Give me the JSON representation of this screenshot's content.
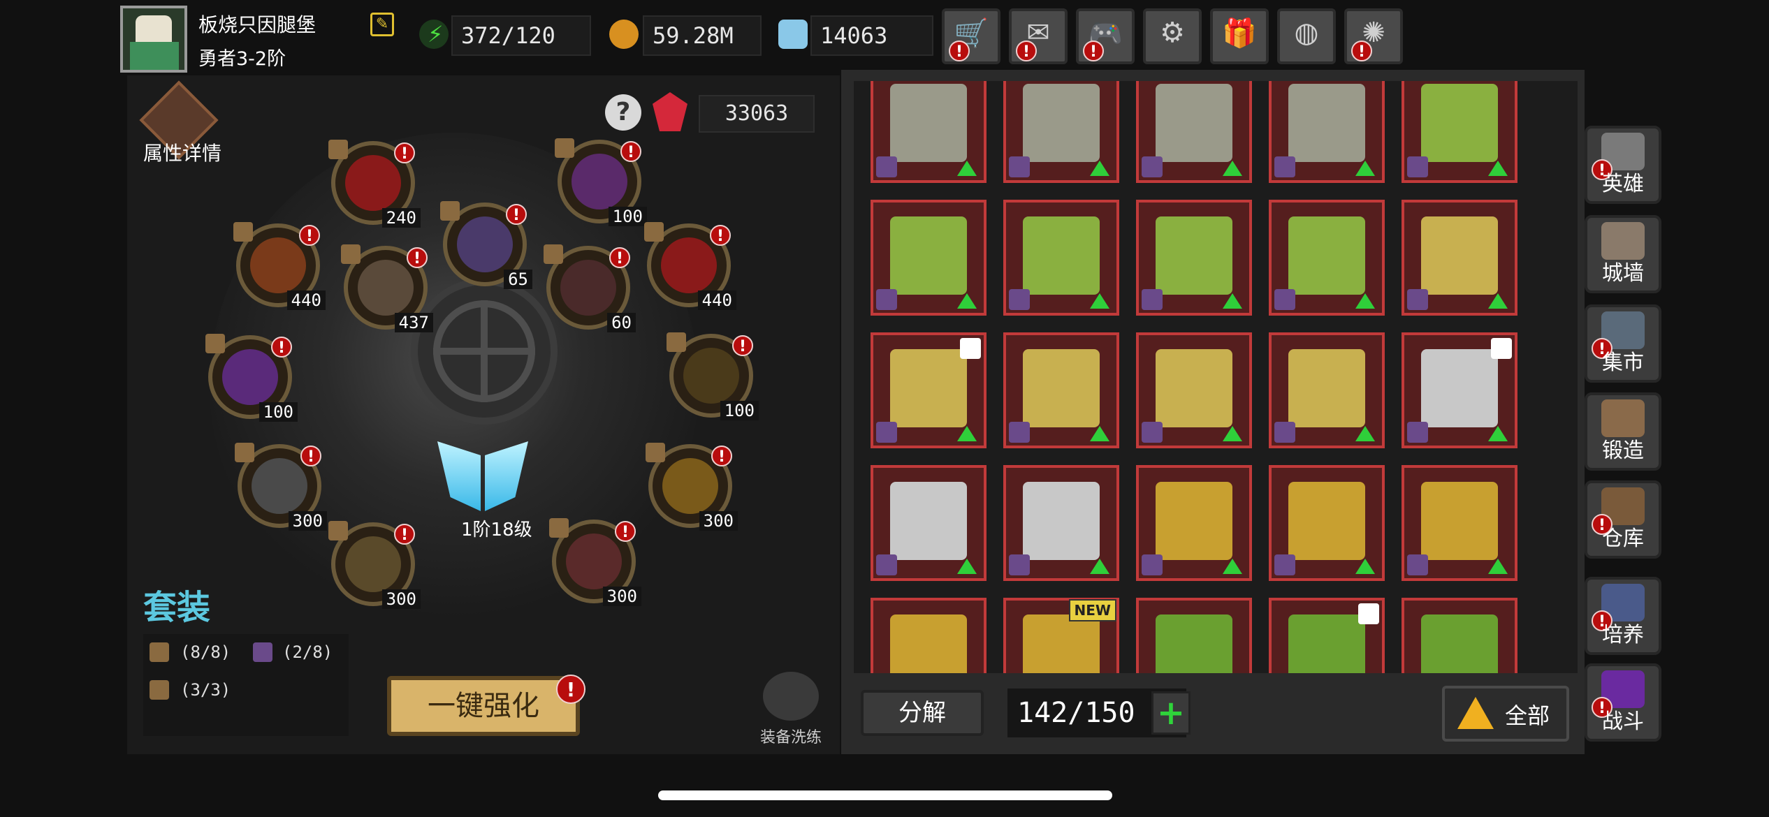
{
  "player": {
    "name": "板烧只因腿堡",
    "rank": "勇者3-2阶"
  },
  "resources": {
    "energy": "372/120",
    "gold": "59.28M",
    "diamonds": "14063"
  },
  "top_buttons": [
    {
      "name": "shop-button",
      "icon": "cart-icon",
      "glyph": "🛒",
      "alert": true
    },
    {
      "name": "mail-button",
      "icon": "mail-icon",
      "glyph": "✉",
      "alert": true
    },
    {
      "name": "games-button",
      "icon": "gamepad-icon",
      "glyph": "🎮",
      "alert": true
    },
    {
      "name": "settings-button",
      "icon": "gear-icon",
      "glyph": "⚙",
      "alert": false
    },
    {
      "name": "gift-button",
      "icon": "gift-icon",
      "glyph": "🎁",
      "alert": false
    },
    {
      "name": "wheel-button",
      "icon": "color-wheel-icon",
      "glyph": "◍",
      "alert": false
    },
    {
      "name": "fireworks-button",
      "icon": "firework-icon",
      "glyph": "✺",
      "alert": true
    }
  ],
  "attributes": {
    "label": "属性详情"
  },
  "gem_count": "33063",
  "equipment_slots": [
    {
      "id": "slot-crossbow",
      "level": "240",
      "color": "#8a1a1a"
    },
    {
      "id": "slot-bow",
      "level": "100",
      "color": "#5a2a6a"
    },
    {
      "id": "slot-dual-blades",
      "level": "440",
      "color": "#7a3a1a"
    },
    {
      "id": "slot-helmet-small",
      "level": "65",
      "color": "#4a3a6a"
    },
    {
      "id": "slot-potion",
      "level": "437",
      "color": "#5a4a3a"
    },
    {
      "id": "slot-bow-red",
      "level": "60",
      "color": "#4a2a2a"
    },
    {
      "id": "slot-axe",
      "level": "440",
      "color": "#8a1a1a"
    },
    {
      "id": "slot-tome",
      "level": "100",
      "color": "#5a2a7a"
    },
    {
      "id": "slot-staff",
      "level": "100",
      "color": "#4a3a1a"
    },
    {
      "id": "slot-helmet",
      "level": "300",
      "color": "#4a4a4a"
    },
    {
      "id": "slot-armor",
      "level": "300",
      "color": "#7a5a1a"
    },
    {
      "id": "slot-ring",
      "level": "300",
      "color": "#5a4a2a"
    },
    {
      "id": "slot-boots",
      "level": "300",
      "color": "#5a2a2a"
    }
  ],
  "wings": {
    "level": "1阶18级"
  },
  "set_bonus": {
    "title": "套装",
    "items": [
      "(8/8)",
      "(2/8)",
      "(3/3)"
    ]
  },
  "enhance_button": "一键强化",
  "refine": {
    "label": "装备洗练"
  },
  "inventory": {
    "items": [
      {
        "kind": "chest",
        "up": true,
        "lock": false,
        "new": false
      },
      {
        "kind": "chest",
        "up": true,
        "lock": false,
        "new": false
      },
      {
        "kind": "chest",
        "up": true,
        "lock": false,
        "new": false
      },
      {
        "kind": "chest",
        "up": true,
        "lock": false,
        "new": false
      },
      {
        "kind": "necklace",
        "up": true,
        "lock": false,
        "new": false
      },
      {
        "kind": "necklace",
        "up": true,
        "lock": false,
        "new": false
      },
      {
        "kind": "necklace",
        "up": true,
        "lock": false,
        "new": false
      },
      {
        "kind": "necklace",
        "up": true,
        "lock": false,
        "new": false
      },
      {
        "kind": "necklace",
        "up": true,
        "lock": false,
        "new": false
      },
      {
        "kind": "gauntlets",
        "up": true,
        "lock": false,
        "new": false
      },
      {
        "kind": "gauntlets",
        "up": true,
        "lock": true,
        "new": false
      },
      {
        "kind": "gauntlets",
        "up": true,
        "lock": false,
        "new": false
      },
      {
        "kind": "gauntlets",
        "up": true,
        "lock": false,
        "new": false
      },
      {
        "kind": "gauntlets",
        "up": true,
        "lock": false,
        "new": false
      },
      {
        "kind": "claw",
        "up": true,
        "lock": true,
        "new": false
      },
      {
        "kind": "claw",
        "up": true,
        "lock": false,
        "new": false
      },
      {
        "kind": "claw",
        "up": true,
        "lock": false,
        "new": false
      },
      {
        "kind": "ring",
        "up": true,
        "lock": false,
        "new": false
      },
      {
        "kind": "ring",
        "up": true,
        "lock": false,
        "new": false
      },
      {
        "kind": "ring",
        "up": true,
        "lock": false,
        "new": false
      },
      {
        "kind": "ring",
        "up": false,
        "lock": false,
        "new": false
      },
      {
        "kind": "ring",
        "up": false,
        "lock": false,
        "new": true
      },
      {
        "kind": "vine",
        "up": false,
        "lock": false,
        "new": false
      },
      {
        "kind": "vine",
        "up": false,
        "lock": true,
        "new": false
      },
      {
        "kind": "vine",
        "up": false,
        "lock": false,
        "new": false
      }
    ],
    "new_label": "NEW",
    "colors": {
      "chest": "#9a9a8a",
      "necklace": "#8ab040",
      "gauntlets": "#c8b050",
      "claw": "#c8c8c8",
      "ring": "#c8a030",
      "vine": "#6aa030"
    }
  },
  "decompose_button": "分解",
  "capacity": "142/150",
  "filter": {
    "label": "全部"
  },
  "nav": [
    {
      "name": "nav-hero",
      "label": "英雄",
      "icon": "helmet-icon",
      "color": "#7a7a7a",
      "alert": true
    },
    {
      "name": "nav-wall",
      "label": "城墙",
      "icon": "castle-wall-icon",
      "color": "#8a7a6a",
      "alert": false
    },
    {
      "name": "nav-market",
      "label": "集市",
      "icon": "market-icon",
      "color": "#5a6a7a",
      "alert": true
    },
    {
      "name": "nav-forge",
      "label": "锻造",
      "icon": "anvil-icon",
      "color": "#8a6a4a",
      "alert": false
    },
    {
      "name": "nav-warehouse",
      "label": "仓库",
      "icon": "warehouse-icon",
      "color": "#7a5a3a",
      "alert": true
    },
    {
      "name": "nav-cultivate",
      "label": "培养",
      "icon": "trophy-icon",
      "color": "#4a5a8a",
      "alert": true
    },
    {
      "name": "nav-battle",
      "label": "战斗",
      "icon": "portal-icon",
      "color": "#6a2aa0",
      "alert": true
    }
  ]
}
